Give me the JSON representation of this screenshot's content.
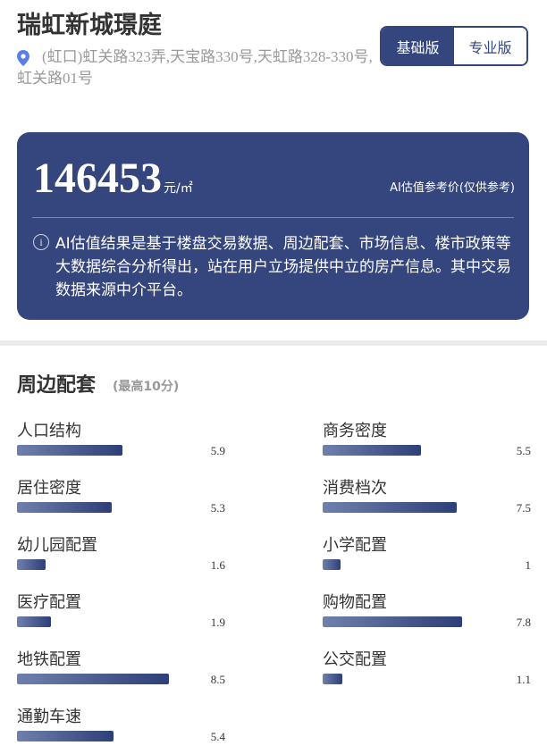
{
  "header": {
    "title": "瑞虹新城璟庭",
    "address": "(虹口)虹关路323弄,天宝路330号,天虹路328-330号,虹关路01号",
    "pin_icon": "location-pin-icon",
    "version_tabs": [
      "基础版",
      "专业版"
    ],
    "active_tab": "基础版"
  },
  "valuation": {
    "price": "146453",
    "unit": "元/㎡",
    "label": "AI估值参考价(仅供参考)",
    "info_icon": "info-icon",
    "disclaimer": "AI估值结果是基于楼盘交易数据、周边配套、市场信息、楼市政策等大数据综合分析得出，站在用户立场提供中立的房产信息。其中交易数据来源中介平台。"
  },
  "amenities": {
    "title": "周边配套",
    "subtitle": "(最高10分)",
    "max_score": 10,
    "items": [
      {
        "label": "人口结构",
        "value": "5.9"
      },
      {
        "label": "商务密度",
        "value": "5.5"
      },
      {
        "label": "居住密度",
        "value": "5.3"
      },
      {
        "label": "消费档次",
        "value": "7.5"
      },
      {
        "label": "幼儿园配置",
        "value": "1.6"
      },
      {
        "label": "小学配置",
        "value": "1"
      },
      {
        "label": "医疗配置",
        "value": "1.9"
      },
      {
        "label": "购物配置",
        "value": "7.8"
      },
      {
        "label": "地铁配置",
        "value": "8.5"
      },
      {
        "label": "公交配置",
        "value": "1.1"
      },
      {
        "label": "通勤车速",
        "value": "5.4"
      }
    ]
  },
  "colors": {
    "primary": "#35467f",
    "bar_start": "#7080ad",
    "bar_end": "#2e3e78",
    "pin": "#5b7fe8"
  }
}
